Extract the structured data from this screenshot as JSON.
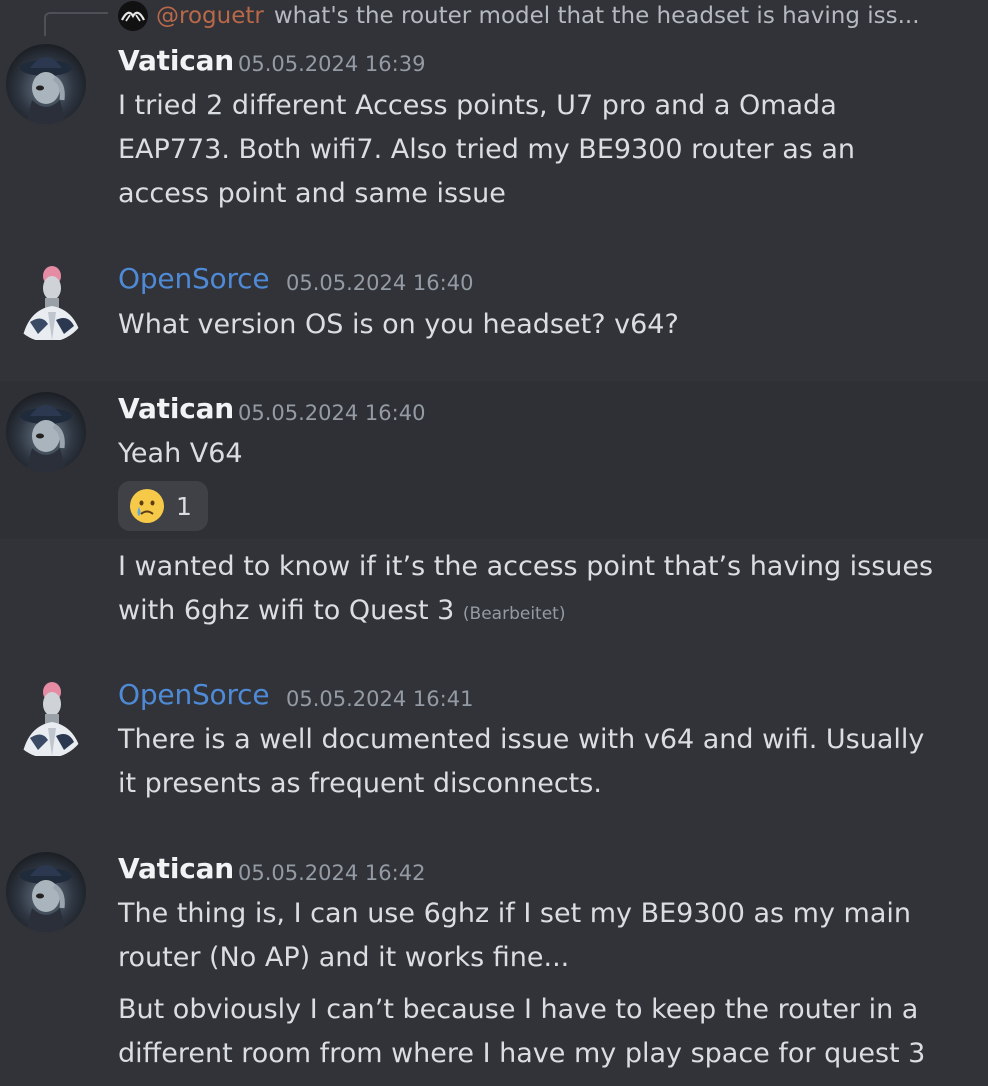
{
  "reply": {
    "author": "@roguetr",
    "text": "what's the router model that the headset is having iss..."
  },
  "messages": [
    {
      "author": "Vatican",
      "timestamp": "05.05.2024 16:39",
      "lines": [
        "I tried 2 different Access points, U7 pro and a Omada",
        "EAP773. Both wifi7. Also tried my BE9300 router as an",
        "access point and same issue"
      ]
    },
    {
      "author": "OpenSorce",
      "timestamp": "05.05.2024 16:40",
      "lines": [
        "What version OS is on you headset? v64?"
      ]
    },
    {
      "author": "Vatican",
      "timestamp": "05.05.2024 16:40",
      "lines": [
        "Yeah V64"
      ],
      "reaction": {
        "emoji": "crying-face",
        "count": "1"
      }
    },
    {
      "continuation": true,
      "lines": [
        "I wanted to know if it’s the access point that’s having issues",
        "with 6ghz wifi to Quest 3"
      ],
      "edited_label": "(Bearbeitet)"
    },
    {
      "author": "OpenSorce",
      "timestamp": "05.05.2024 16:41",
      "lines": [
        "There is a well documented issue with v64 and wifi. Usually",
        "it presents as frequent disconnects."
      ]
    },
    {
      "author": "Vatican",
      "timestamp": "05.05.2024 16:42",
      "lines": [
        "The thing is, I can use 6ghz if I set my BE9300 as my main",
        "router (No AP) and it works fine..."
      ]
    },
    {
      "continuation": true,
      "lines": [
        "But obviously I can’t because I have to keep the router in a",
        "different room from where I have my play space for quest 3"
      ]
    }
  ],
  "colors": {
    "background": "#313338",
    "hover_background": "#2e3035",
    "text": "#dbdee1",
    "timestamp": "#949ba4",
    "author_vatican": "#f2f3f5",
    "author_opensorce": "#4f8ad6",
    "reply_author": "#b9684a"
  }
}
